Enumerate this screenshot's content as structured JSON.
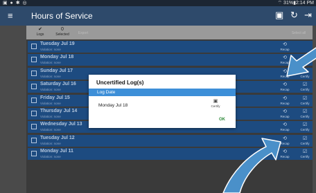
{
  "status_bar": {
    "left_icons": "▣ ● ✱ ◎",
    "right_text": "⌔ 31%▮2:14 PM"
  },
  "app_bar": {
    "menu_icon": "≡",
    "title": "Hours of Service",
    "actions": [
      "▣",
      "↻",
      "⇥"
    ]
  },
  "tabs": [
    {
      "icon": "✔",
      "label": "Logs"
    },
    {
      "icon": "0",
      "label": "Selected"
    },
    {
      "icon": "",
      "label": "Export"
    },
    {
      "icon": "",
      "label": "Select all"
    }
  ],
  "log_rows": [
    {
      "date": "Tuesday Jul 19",
      "violation": "Violation: none",
      "recap_icon": "⟲",
      "recap_label": "Recap",
      "certify_icon": "",
      "certify_label": ""
    },
    {
      "date": "Monday Jul 18",
      "violation": "Violation: none",
      "recap_icon": "⟲",
      "recap_label": "Recap",
      "certify_icon": "",
      "certify_label": ""
    },
    {
      "date": "Sunday Jul 17",
      "violation": "Violation: none",
      "recap_icon": "⟲",
      "recap_label": "Recap",
      "certify_icon": "☑",
      "certify_label": "Certify"
    },
    {
      "date": "Saturday Jul 16",
      "violation": "Violation: none",
      "recap_icon": "⟲",
      "recap_label": "Recap",
      "certify_icon": "☑",
      "certify_label": "Certify"
    },
    {
      "date": "Friday Jul 15",
      "violation": "Violation: none",
      "recap_icon": "⟲",
      "recap_label": "Recap",
      "certify_icon": "☑",
      "certify_label": "Certify"
    },
    {
      "date": "Thursday Jul 14",
      "violation": "Violation: none",
      "recap_icon": "⟲",
      "recap_label": "Recap",
      "certify_icon": "☑",
      "certify_label": "Certify"
    },
    {
      "date": "Wednesday Jul 13",
      "violation": "Violation: none",
      "recap_icon": "⟲",
      "recap_label": "Recap",
      "certify_icon": "☑",
      "certify_label": "Certify"
    },
    {
      "date": "Tuesday Jul 12",
      "violation": "Violation: none",
      "recap_icon": "⟲",
      "recap_label": "Recap",
      "certify_icon": "☑",
      "certify_label": "Certify"
    },
    {
      "date": "Monday Jul 11",
      "violation": "Violation: none",
      "recap_icon": "⟲",
      "recap_label": "Recap",
      "certify_icon": "☑",
      "certify_label": "Certify"
    }
  ],
  "dialog": {
    "title": "Uncertified Log(s)",
    "column_header": "Log Date",
    "entry_date": "Monday Jul 18",
    "certify_icon": "▣",
    "certify_label": "Certify",
    "ok_label": "OK"
  },
  "colors": {
    "app_bar": "#2e4a6b",
    "row": "#1d4b80",
    "dialog_header": "#3d8fd8",
    "ok": "#2e8a3a",
    "annotation_arrow": "#4a90c9"
  }
}
